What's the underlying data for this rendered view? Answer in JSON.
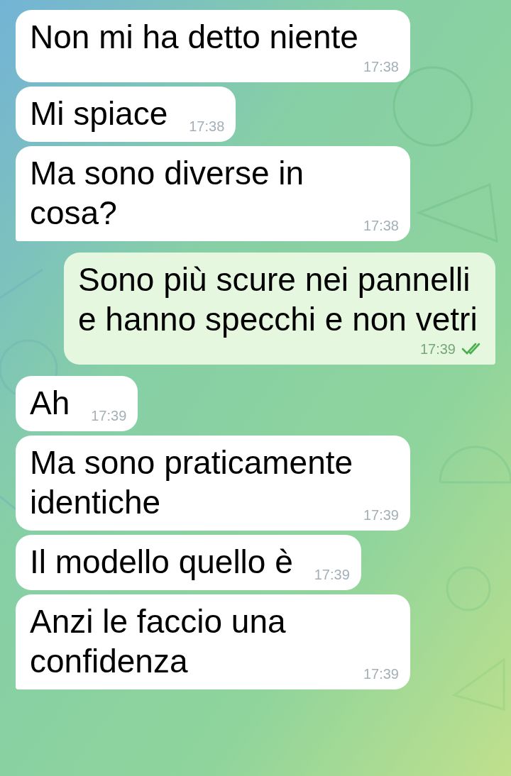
{
  "messages": [
    {
      "kind": "incoming",
      "text": "Non mi ha detto niente",
      "time": "17:38"
    },
    {
      "kind": "incoming",
      "text": "Mi spiace",
      "time": "17:38"
    },
    {
      "kind": "incoming",
      "text": "Ma sono diverse in cosa?",
      "time": "17:38"
    },
    {
      "kind": "outgoing",
      "text": "Sono più scure nei pannelli e hanno specchi e non vetri",
      "time": "17:39",
      "read": true
    },
    {
      "kind": "incoming",
      "text": "Ah",
      "time": "17:39"
    },
    {
      "kind": "incoming",
      "text": "Ma sono praticamente identiche",
      "time": "17:39"
    },
    {
      "kind": "incoming",
      "text": "Il modello quello è",
      "time": "17:39"
    },
    {
      "kind": "incoming",
      "text": "Anzi le faccio una confidenza",
      "time": "17:39"
    }
  ]
}
